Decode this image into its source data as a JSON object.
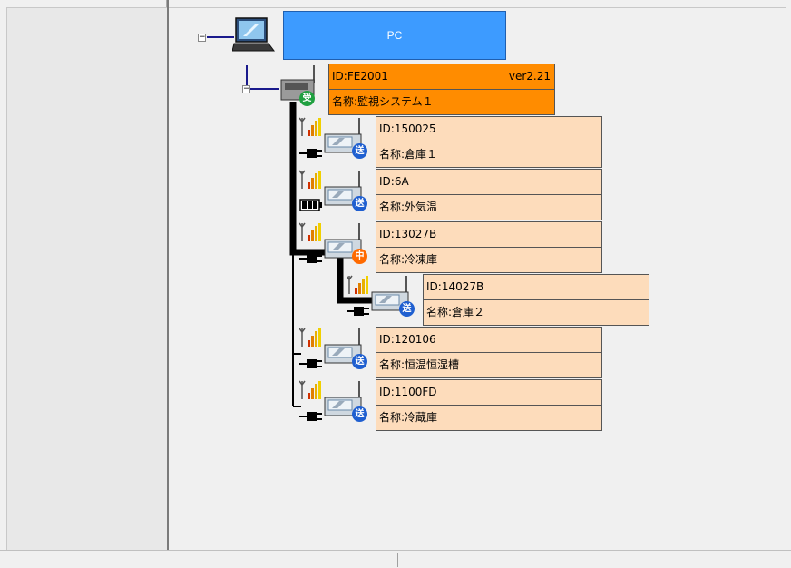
{
  "pc": {
    "label": "PC"
  },
  "receiver": {
    "id": "ID:FE2001",
    "version": "ver2.21",
    "name": "名称:監視システム１",
    "badge": "受"
  },
  "devices": [
    {
      "id": "ID:150025",
      "name": "名称:倉庫１",
      "badge": "送",
      "power": "ac"
    },
    {
      "id": "ID:6A",
      "name": "名称:外気温",
      "badge": "送",
      "power": "battery"
    },
    {
      "id": "ID:13027B",
      "name": "名称:冷凍庫",
      "badge": "中",
      "power": "ac"
    },
    {
      "id": "ID:14027B",
      "name": "名称:倉庫２",
      "badge": "送",
      "power": "ac"
    },
    {
      "id": "ID:120106",
      "name": "名称:恒温恒湿槽",
      "badge": "送",
      "power": "ac"
    },
    {
      "id": "ID:1100FD",
      "name": "名称:冷蔵庫",
      "badge": "送",
      "power": "ac"
    }
  ],
  "colors": {
    "pc": "#3d9bff",
    "receiver": "#ff8c00",
    "sensor": "#fddcbb",
    "route": "#000000"
  },
  "icons": {
    "pc": "laptop-icon",
    "receiver": "base-station-icon",
    "sensor": "data-logger-icon",
    "signal": "signal-strength-icon",
    "ac_power": "ac-plug-icon",
    "battery": "battery-icon"
  }
}
